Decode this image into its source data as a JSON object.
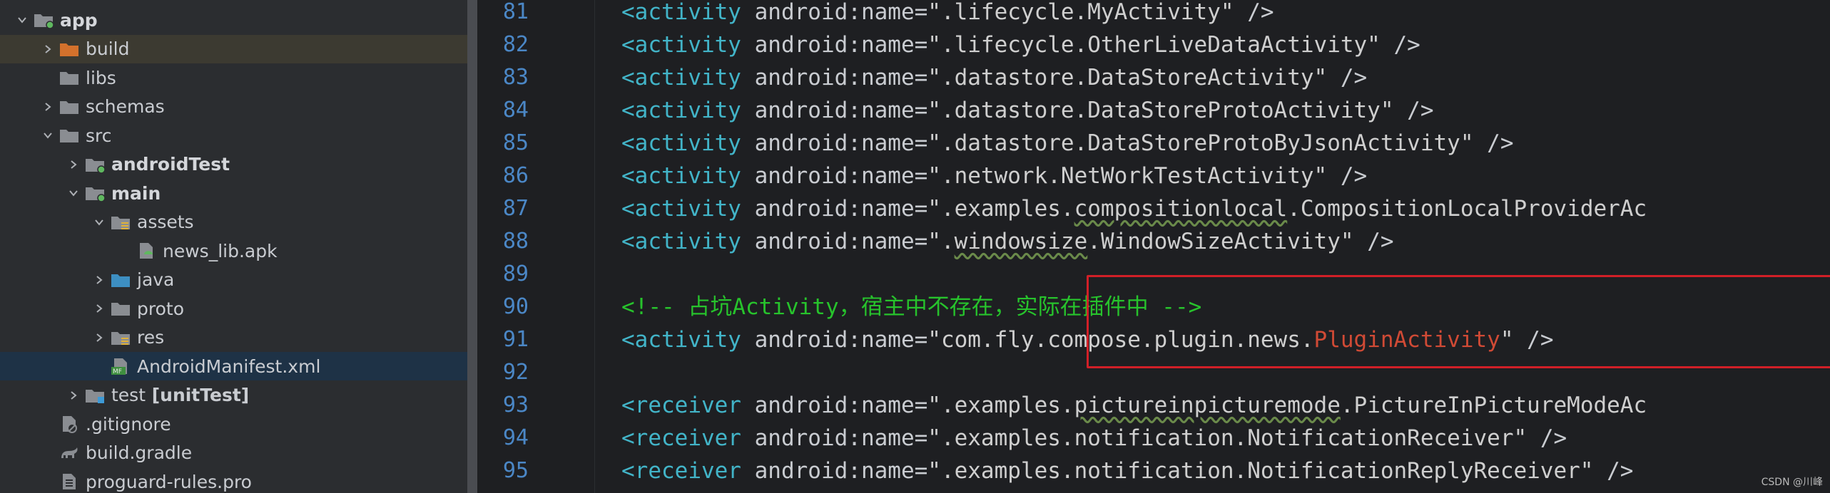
{
  "tree": {
    "items": [
      {
        "label": "app",
        "icon": "module-folder-icon",
        "depth": 0,
        "chevron": "down",
        "bold": true,
        "state": "normal"
      },
      {
        "label": "build",
        "icon": "build-folder-icon",
        "depth": 1,
        "chevron": "right",
        "bold": false,
        "state": "highlighted"
      },
      {
        "label": "libs",
        "icon": "folder-icon",
        "depth": 1,
        "chevron": "none",
        "bold": false,
        "state": "normal"
      },
      {
        "label": "schemas",
        "icon": "folder-icon",
        "depth": 1,
        "chevron": "right",
        "bold": false,
        "state": "normal"
      },
      {
        "label": "src",
        "icon": "folder-icon",
        "depth": 1,
        "chevron": "down",
        "bold": false,
        "state": "normal"
      },
      {
        "label": "androidTest",
        "icon": "test-source-folder-icon",
        "depth": 2,
        "chevron": "right",
        "bold": true,
        "state": "normal"
      },
      {
        "label": "main",
        "icon": "source-root-folder-icon",
        "depth": 2,
        "chevron": "down",
        "bold": true,
        "state": "normal"
      },
      {
        "label": "assets",
        "icon": "resource-folder-icon",
        "depth": 3,
        "chevron": "down",
        "bold": false,
        "state": "normal"
      },
      {
        "label": "news_lib.apk",
        "icon": "apk-file-icon",
        "depth": 4,
        "chevron": "none",
        "bold": false,
        "state": "normal"
      },
      {
        "label": "java",
        "icon": "java-source-folder-icon",
        "depth": 3,
        "chevron": "right",
        "bold": false,
        "state": "normal"
      },
      {
        "label": "proto",
        "icon": "folder-icon",
        "depth": 3,
        "chevron": "right",
        "bold": false,
        "state": "normal"
      },
      {
        "label": "res",
        "icon": "resource-folder-icon",
        "depth": 3,
        "chevron": "right",
        "bold": false,
        "state": "normal"
      },
      {
        "label": "AndroidManifest.xml",
        "icon": "manifest-file-icon",
        "depth": 3,
        "chevron": "none",
        "bold": false,
        "state": "selected"
      },
      {
        "label": "test",
        "extra": " [unitTest]",
        "icon": "test-folder-icon",
        "depth": 2,
        "chevron": "right",
        "bold": false,
        "state": "normal"
      },
      {
        "label": ".gitignore",
        "icon": "gitignore-file-icon",
        "depth": 1,
        "chevron": "none",
        "bold": false,
        "state": "normal"
      },
      {
        "label": "build.gradle",
        "icon": "gradle-file-icon",
        "depth": 1,
        "chevron": "none",
        "bold": false,
        "state": "normal"
      },
      {
        "label": "proguard-rules.pro",
        "icon": "text-file-icon",
        "depth": 1,
        "chevron": "none",
        "bold": false,
        "state": "normal"
      }
    ]
  },
  "editor": {
    "lines": [
      {
        "num": "81",
        "tokens": [
          [
            "tag",
            "<activity"
          ],
          [
            "attr",
            " android:name="
          ],
          [
            "str",
            "\".lifecycle.MyActivity\""
          ],
          [
            "attr",
            " />"
          ]
        ]
      },
      {
        "num": "82",
        "tokens": [
          [
            "tag",
            "<activity"
          ],
          [
            "attr",
            " android:name="
          ],
          [
            "str",
            "\".lifecycle.OtherLiveDataActivity\""
          ],
          [
            "attr",
            " />"
          ]
        ]
      },
      {
        "num": "83",
        "tokens": [
          [
            "tag",
            "<activity"
          ],
          [
            "attr",
            " android:name="
          ],
          [
            "str",
            "\".datastore.DataStoreActivity\""
          ],
          [
            "attr",
            " />"
          ]
        ]
      },
      {
        "num": "84",
        "tokens": [
          [
            "tag",
            "<activity"
          ],
          [
            "attr",
            " android:name="
          ],
          [
            "str",
            "\".datastore.DataStoreProtoActivity\""
          ],
          [
            "attr",
            " />"
          ]
        ]
      },
      {
        "num": "85",
        "tokens": [
          [
            "tag",
            "<activity"
          ],
          [
            "attr",
            " android:name="
          ],
          [
            "str",
            "\".datastore.DataStoreProtoByJsonActivity\""
          ],
          [
            "attr",
            " />"
          ]
        ]
      },
      {
        "num": "86",
        "tokens": [
          [
            "tag",
            "<activity"
          ],
          [
            "attr",
            " android:name="
          ],
          [
            "str",
            "\".network.NetWorkTestActivity\""
          ],
          [
            "attr",
            " />"
          ]
        ]
      },
      {
        "num": "87",
        "tokens": [
          [
            "tag",
            "<activity"
          ],
          [
            "attr",
            " android:name="
          ],
          [
            "str",
            "\".examples."
          ],
          [
            "under",
            "compositionlocal"
          ],
          [
            "str",
            ".CompositionLocalProviderAc"
          ]
        ]
      },
      {
        "num": "88",
        "tokens": [
          [
            "tag",
            "<activity"
          ],
          [
            "attr",
            " android:name="
          ],
          [
            "str",
            "\"."
          ],
          [
            "under",
            "windowsize"
          ],
          [
            "str",
            ".WindowSizeActivity\""
          ],
          [
            "attr",
            " />"
          ]
        ]
      },
      {
        "num": "89",
        "tokens": []
      },
      {
        "num": "90",
        "tokens": [
          [
            "comment",
            "<!-- 占坑Activity，宿主中不存在，实际在插件中 -->"
          ]
        ]
      },
      {
        "num": "91",
        "tokens": [
          [
            "tag",
            "<activity"
          ],
          [
            "attr",
            " android:name="
          ],
          [
            "str",
            "\"com.fly.compose.plugin.news."
          ],
          [
            "red",
            "PluginActivity"
          ],
          [
            "str",
            "\""
          ],
          [
            "attr",
            " />"
          ]
        ]
      },
      {
        "num": "92",
        "tokens": []
      },
      {
        "num": "93",
        "tokens": [
          [
            "tag",
            "<receiver"
          ],
          [
            "attr",
            " android:name="
          ],
          [
            "str",
            "\".examples."
          ],
          [
            "under",
            "pictureinpicturemode"
          ],
          [
            "str",
            ".PictureInPictureModeAc"
          ]
        ]
      },
      {
        "num": "94",
        "tokens": [
          [
            "tag",
            "<receiver"
          ],
          [
            "attr",
            " android:name="
          ],
          [
            "str",
            "\".examples.notification.NotificationReceiver\""
          ],
          [
            "attr",
            " />"
          ]
        ]
      },
      {
        "num": "95",
        "tokens": [
          [
            "tag",
            "<receiver"
          ],
          [
            "attr",
            " android:name="
          ],
          [
            "str",
            "\".examples.notification.NotificationReplyReceiver\""
          ],
          [
            "attr",
            " />"
          ]
        ]
      }
    ]
  },
  "watermark": "CSDN @川峰",
  "colors": {
    "tree_bg": "#2b2d30",
    "editor_bg": "#1e1f22",
    "line_number": "#4b87c6",
    "tag": "#42b4c8",
    "comment": "#27c32c",
    "red_class": "#d04a35",
    "highlight_border": "#d11f27"
  }
}
